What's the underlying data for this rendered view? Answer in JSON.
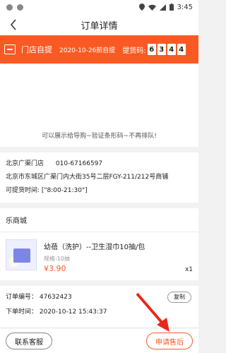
{
  "statusbar": {
    "time": "3:45"
  },
  "header": {
    "title": "订单详情"
  },
  "pickup": {
    "mode": "门店自提",
    "date": "2020-10-26前自提",
    "code_label": "提货码:",
    "code": [
      "6",
      "3",
      "4",
      "4"
    ]
  },
  "qr": {
    "hint": "可以展示给导购~验证条形码~不再排队!"
  },
  "store": {
    "name": "北京广渠门店",
    "phone": "010-67166597",
    "address": "北京市东城区广渠门内大街35号二层FGY-211/212号商铺",
    "hours": "可提货时间: [\"8:00-21:30\"]"
  },
  "goods": {
    "shop": "乐商城",
    "item": {
      "name": "幼蓓（洗护）--卫生湿巾10抽/包",
      "spec": "规格:10抽",
      "price": "¥3.90",
      "qty": "x1"
    }
  },
  "order": {
    "number": "订单编号： 47632423",
    "time": "下单时间： 2020-10-12 15:43:37",
    "copy_label": "复制"
  },
  "bottom": {
    "service": "联系客服",
    "aftersale": "申请售后"
  },
  "colors": {
    "accent": "#f95a23",
    "arrow": "#e8281a"
  }
}
